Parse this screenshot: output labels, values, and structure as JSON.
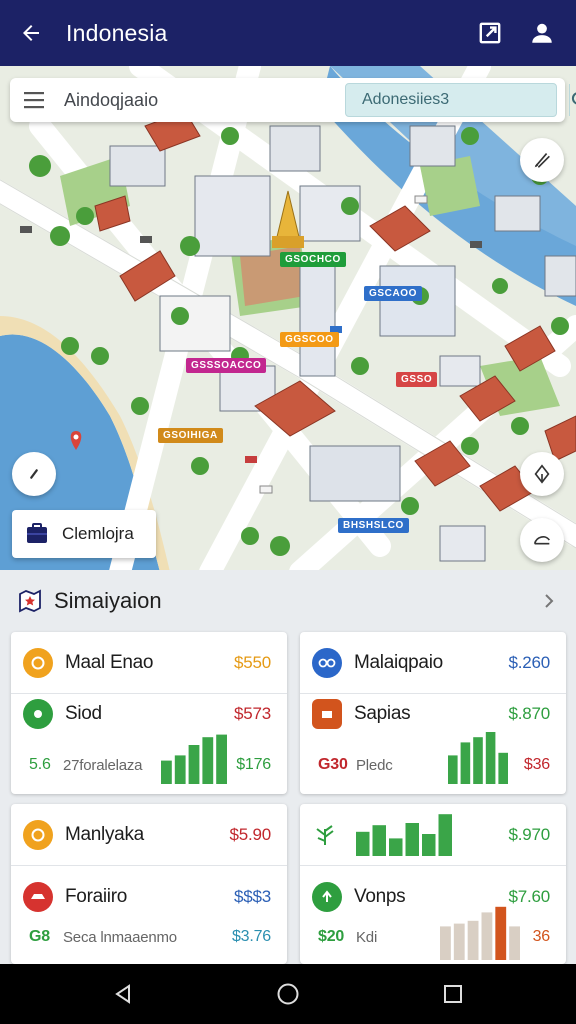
{
  "appbar": {
    "title": "Indonesia",
    "back_icon": "arrow-left-icon",
    "actions": [
      "open-external-icon",
      "account-icon"
    ],
    "color": "#1c2266"
  },
  "search": {
    "location": "Aindoqjaaio",
    "placeholder": "Adonesiies3"
  },
  "map": {
    "labels": [
      {
        "text": "GSOCHCO",
        "color": "#1f9d3a"
      },
      {
        "text": "GSCAOO",
        "color": "#2f6fc9"
      },
      {
        "text": "GGSCOO",
        "color": "#f39a16"
      },
      {
        "text": "GSSSOACCO",
        "color": "#c2278f"
      },
      {
        "text": "GSOIHIGA",
        "color": "#d18a1a"
      },
      {
        "text": "GSSO",
        "color": "#d64545"
      },
      {
        "text": "BHSHSLCO",
        "color": "#2f6fc9"
      }
    ],
    "chip_label": "Clemlojra"
  },
  "panel": {
    "title": "Simaiyaion",
    "cards": [
      {
        "top": {
          "name": "Maal Enao",
          "price": "$550",
          "price_color": "#e59a14",
          "icon_color": "#f0a21e"
        },
        "bottom": {
          "name": "Siod",
          "price": "$573",
          "price_color": "#c1272d",
          "icon_color": "#2e9e3f",
          "sub_left": "5.6",
          "sub_mid": "27foralelaza",
          "sub_right": "$176",
          "sub_right_color": "#2e9e3f",
          "bars": [
            0.45,
            0.55,
            0.75,
            0.9,
            0.95
          ],
          "bar_color": "#3aa548"
        }
      },
      {
        "top": {
          "name": "Malaiqpaio",
          "price": "$.260",
          "price_color": "#2b5fb5",
          "icon_color": "#2b67c9"
        },
        "bottom": {
          "name": "Sapias",
          "price": "$.870",
          "price_color": "#2e9e3f",
          "icon_color": "#d2541d",
          "sub_left": "G30",
          "sub_mid": "Pledc",
          "sub_right": "$36",
          "sub_right_color": "#c1272d",
          "bars": [
            0.55,
            0.8,
            0.9,
            1.0,
            0.6
          ],
          "bar_color": "#3aa548"
        }
      },
      {
        "top": {
          "name": "Manlyaka",
          "price": "$5.90",
          "price_color": "#c1272d",
          "icon_color": "#f0a21e"
        },
        "bottom": {
          "name": "Foraiiro",
          "price": "$$$3",
          "price_color": "#2b5fb5",
          "icon_color": "#d6332f",
          "sub_left": "G8",
          "sub_mid": "Seca lnmaaenmo",
          "sub_right": "$3.76",
          "sub_right_color": "#2b8fb0",
          "bars": [],
          "bar_color": "#3aa548"
        }
      },
      {
        "top": {
          "name": "",
          "price": "$.970",
          "price_color": "#2e9e3f",
          "icon_color": "#2e9e3f",
          "bars": [
            0.55,
            0.7,
            0.4,
            0.75,
            0.5,
            0.95
          ]
        },
        "bottom": {
          "name": "Vonps",
          "price": "$7.60",
          "price_color": "#2e9e3f",
          "icon_color": "#2e9e3f",
          "sub_left": "$20",
          "sub_mid": "Kdi",
          "sub_right": "36",
          "sub_right_color": "#d2541d",
          "bars": [
            0.6,
            0.65,
            0.7,
            0.85,
            0.95,
            0.6
          ],
          "bar_color": "#d9cfc4"
        }
      }
    ]
  },
  "navbar": {
    "icons": [
      "back-triangle-icon",
      "home-circle-icon",
      "recents-square-icon"
    ]
  }
}
